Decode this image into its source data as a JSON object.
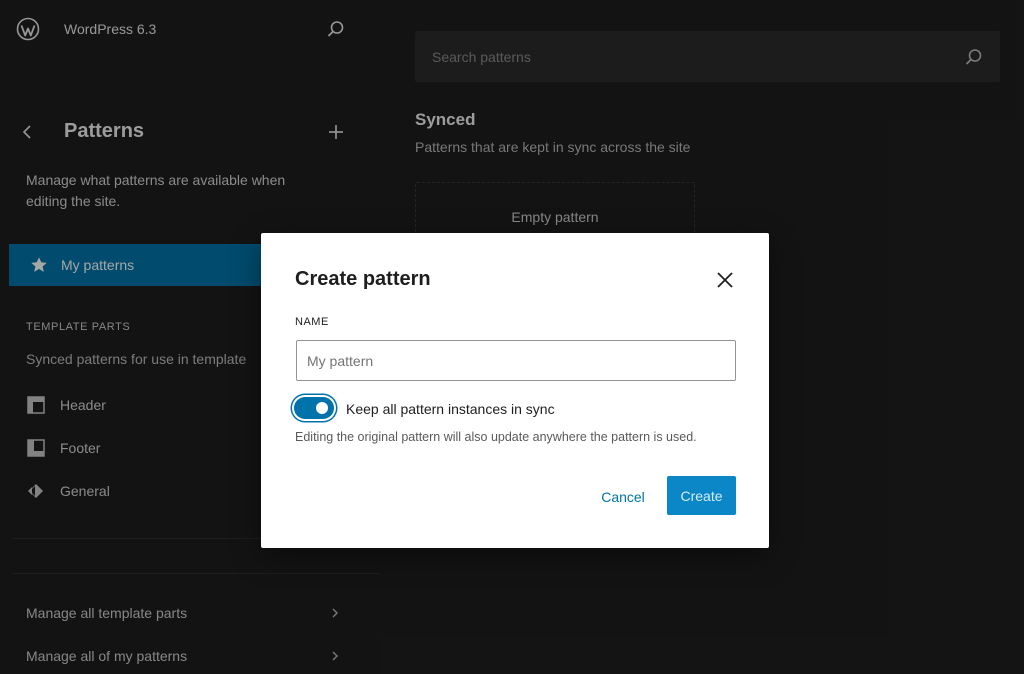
{
  "sidebar": {
    "site_title": "WordPress 6.3",
    "title": "Patterns",
    "description": "Manage what patterns are available when editing the site.",
    "active_item": "My patterns",
    "section_heading": "TEMPLATE PARTS",
    "section_description": "Synced patterns for use in template",
    "items": [
      {
        "label": "Header",
        "icon": "header-icon"
      },
      {
        "label": "Footer",
        "icon": "footer-icon"
      },
      {
        "label": "General",
        "icon": "general-icon"
      }
    ],
    "footer_links": [
      {
        "label": "Manage all template parts"
      },
      {
        "label": "Manage all of my patterns"
      }
    ]
  },
  "main": {
    "search_placeholder": "Search patterns",
    "section_title": "Synced",
    "section_description": "Patterns that are kept in sync across the site",
    "empty_card_label": "Empty pattern"
  },
  "modal": {
    "title": "Create pattern",
    "name_label": "NAME",
    "name_placeholder": "My pattern",
    "name_value": "",
    "sync_label": "Keep all pattern instances in sync",
    "sync_enabled": true,
    "sync_help": "Editing the original pattern will also update anywhere the pattern is used.",
    "cancel_label": "Cancel",
    "create_label": "Create"
  },
  "colors": {
    "accent": "#0073aa",
    "background": "#1e1e1e",
    "modal_background": "#ffffff"
  }
}
